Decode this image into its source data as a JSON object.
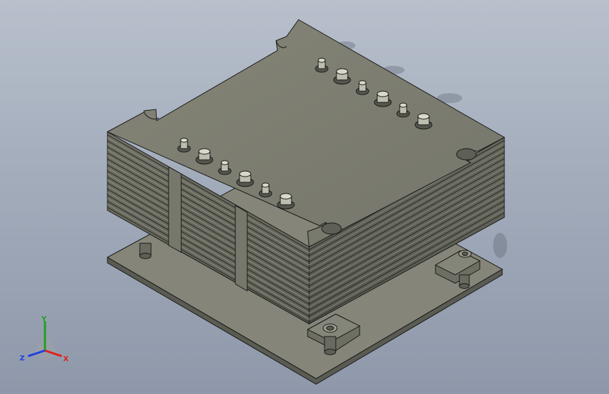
{
  "viewport": {
    "background_top": "#b8c0cc",
    "background_bottom": "#8e98aa"
  },
  "model": {
    "part_color": "#7b7c6e",
    "edge_color": "#1a1a1a",
    "fin_count": 26,
    "left_screw_row": 6,
    "right_screw_row": 6
  },
  "triad": {
    "x_label": "X",
    "y_label": "Y",
    "z_label": "Z",
    "x_color": "#e02020",
    "y_color": "#20a020",
    "z_color": "#2040e0"
  }
}
